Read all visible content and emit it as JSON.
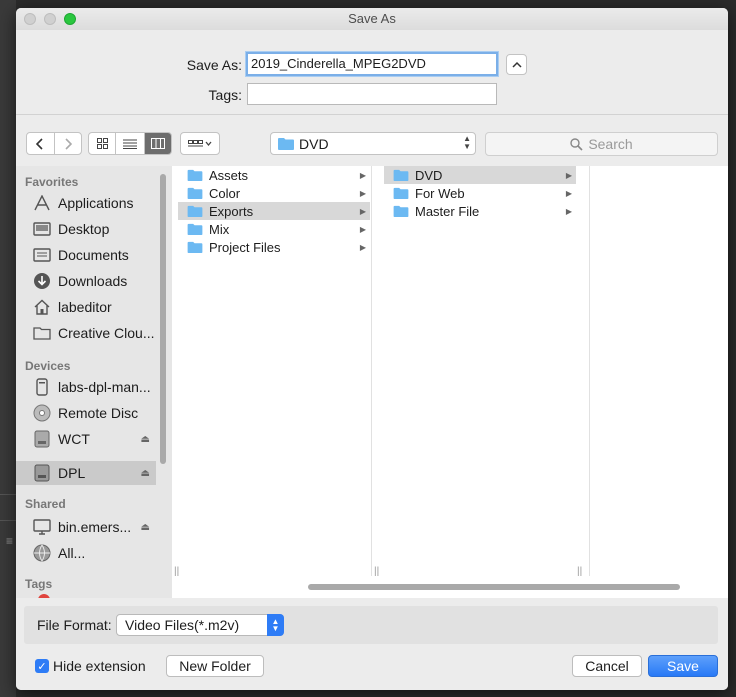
{
  "window": {
    "title": "Save As"
  },
  "save_as": {
    "label": "Save As:",
    "value": "2019_Cinderella_MPEG2DVD"
  },
  "tags": {
    "label": "Tags:",
    "value": ""
  },
  "location": {
    "current": "DVD"
  },
  "search": {
    "placeholder": "Search"
  },
  "sidebar": {
    "favorites": {
      "header": "Favorites",
      "items": [
        {
          "label": "Applications",
          "icon": "applications-icon"
        },
        {
          "label": "Desktop",
          "icon": "desktop-icon"
        },
        {
          "label": "Documents",
          "icon": "documents-icon"
        },
        {
          "label": "Downloads",
          "icon": "downloads-icon"
        },
        {
          "label": "labeditor",
          "icon": "home-icon"
        },
        {
          "label": "Creative Clou...",
          "icon": "folder-icon"
        }
      ]
    },
    "devices": {
      "header": "Devices",
      "items": [
        {
          "label": "labs-dpl-man...",
          "icon": "computer-icon"
        },
        {
          "label": "Remote Disc",
          "icon": "disc-icon"
        },
        {
          "label": "WCT",
          "icon": "drive-icon"
        },
        {
          "label": "DPL",
          "icon": "drive-icon"
        }
      ]
    },
    "shared": {
      "header": "Shared",
      "items": [
        {
          "label": "bin.emers...",
          "icon": "monitor-icon"
        },
        {
          "label": "All...",
          "icon": "globe-icon"
        }
      ]
    },
    "tags": {
      "header": "Tags"
    }
  },
  "columns": {
    "col1": [
      "Assets",
      "Color",
      "Exports",
      "Mix",
      "Project Files"
    ],
    "col2": [
      "DVD",
      "For Web",
      "Master File"
    ]
  },
  "file_format": {
    "label": "File Format:",
    "value": "Video Files(*.m2v)"
  },
  "hide_extension": {
    "label": "Hide extension",
    "checked": true
  },
  "buttons": {
    "new_folder": "New Folder",
    "cancel": "Cancel",
    "save": "Save"
  },
  "colors": {
    "accent": "#2e7cf6",
    "folder": "#6cb9f2"
  }
}
